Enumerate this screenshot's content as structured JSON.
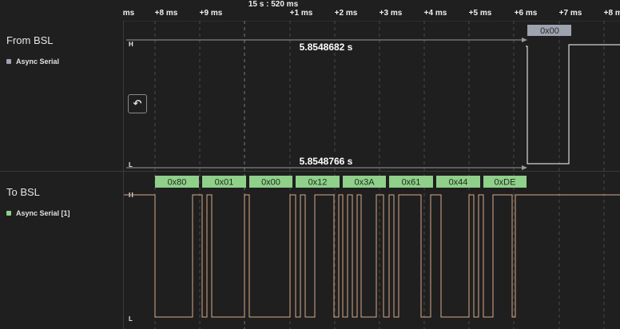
{
  "timeline": {
    "center_time": "15 s : 520 ms",
    "ticks": [
      {
        "label": "ms"
      },
      {
        "label": "+8 ms"
      },
      {
        "label": "+9 ms"
      },
      {
        "label": "+1 ms"
      },
      {
        "label": "+2 ms"
      },
      {
        "label": "+3 ms"
      },
      {
        "label": "+4 ms"
      },
      {
        "label": "+5 ms"
      },
      {
        "label": "+6 ms"
      },
      {
        "label": "+7 ms"
      },
      {
        "label": "+8 ms"
      }
    ]
  },
  "channels": [
    {
      "name": "From BSL",
      "analyzer": "Async Serial",
      "analyzer_color": "#9ea3b0",
      "high_label": "H",
      "low_label": "L",
      "decoded_bytes": [
        "0x00"
      ],
      "measurement_top": "5.8548682 s",
      "measurement_bottom": "5.8548766 s"
    },
    {
      "name": "To BSL",
      "analyzer": "Async Serial [1]",
      "analyzer_color": "#8fd08a",
      "high_label": "H",
      "low_label": "L",
      "decoded_bytes": [
        "0x80",
        "0x01",
        "0x00",
        "0x12",
        "0x3A",
        "0x61",
        "0x44",
        "0xDE"
      ]
    }
  ],
  "trigger_button": {
    "icon": "trigger-edge-icon",
    "glyph": "↶"
  },
  "colors": {
    "signal": "#d9a98a",
    "line_white": "#ffffff",
    "byte_green": "#8fd08a",
    "byte_gray": "#9ea3b0"
  }
}
